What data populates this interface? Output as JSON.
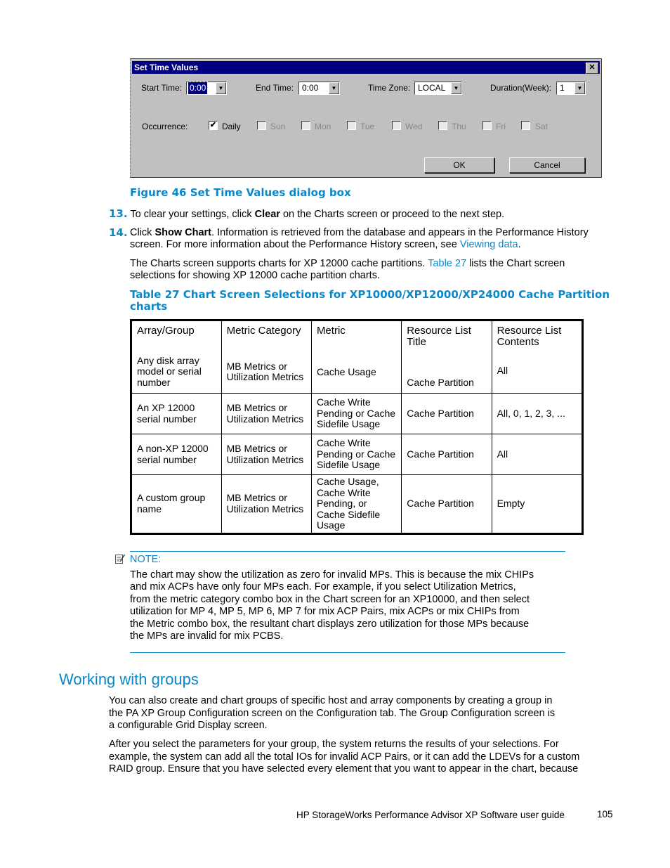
{
  "dialog": {
    "title": "Set Time Values",
    "close_icon": "close-icon",
    "start_time": {
      "label": "Start Time:",
      "value": "0:00"
    },
    "end_time": {
      "label": "End Time:",
      "value": "0:00"
    },
    "time_zone": {
      "label": "Time Zone:",
      "value": "LOCAL"
    },
    "duration": {
      "label": "Duration(Week):",
      "value": "1"
    },
    "occurrence_label": "Occurrence:",
    "occurrences": [
      {
        "label": "Daily",
        "checked": true,
        "enabled": true
      },
      {
        "label": "Sun",
        "checked": false,
        "enabled": false
      },
      {
        "label": "Mon",
        "checked": false,
        "enabled": false
      },
      {
        "label": "Tue",
        "checked": false,
        "enabled": false
      },
      {
        "label": "Wed",
        "checked": false,
        "enabled": false
      },
      {
        "label": "Thu",
        "checked": false,
        "enabled": false
      },
      {
        "label": "Fri",
        "checked": false,
        "enabled": false
      },
      {
        "label": "Sat",
        "checked": false,
        "enabled": false
      }
    ],
    "ok_label": "OK",
    "cancel_label": "Cancel"
  },
  "figure_caption": "Figure 46 Set Time Values dialog box",
  "steps": [
    {
      "num": "13.",
      "pre": "To clear your settings, click ",
      "bold": "Clear",
      "post": " on the Charts screen or proceed to the next step."
    },
    {
      "num": "14.",
      "pre": "Click ",
      "bold": "Show Chart",
      "post": ".  Information is retrieved from the database and appears in the Performance History screen.  For more information about the Performance History screen, see ",
      "link": "Viewing data",
      "end": "."
    }
  ],
  "para_charts": {
    "pre": "The Charts screen supports charts for XP 12000 cache partitions. ",
    "link": "Table 27",
    "post": " lists the Chart screen selections for showing XP 12000 cache partition charts."
  },
  "table_caption": "Table 27 Chart Screen Selections for XP10000/XP12000/XP24000 Cache Partition charts",
  "table": {
    "headers": [
      "Array/Group",
      "Metric Category",
      "Metric",
      "Resource List Title",
      "Resource  List Contents"
    ],
    "rows": [
      [
        "Any disk array model or serial number",
        "MB Metrics or Utilization Metrics",
        "Cache Usage",
        "Cache Partition",
        "All"
      ],
      [
        "An XP 12000 serial number",
        "MB Metrics or Utilization Metrics",
        "Cache  Write Pending or Cache Sidefile Usage",
        "Cache Partition",
        "All, 0, 1, 2, 3, ..."
      ],
      [
        "A non-XP 12000 serial number",
        "MB Metrics or Utilization Metrics",
        "Cache  Write Pending or Cache Sidefile Usage",
        "Cache Partition",
        "All"
      ],
      [
        "A custom group name",
        "MB Metrics or Utilization Metrics",
        "Cache Usage, Cache  Write Pending, or Cache Sidefile Usage",
        "Cache Partition",
        "Empty"
      ]
    ]
  },
  "note": {
    "icon": "note-icon",
    "label": "NOTE:",
    "lines": [
      "The chart may show the utilization as zero for invalid MPs.  This is because the mix CHIPs",
      "and mix ACPs have only four MPs each.  For example, if you select Utilization Metrics,",
      "from the metric category combo box in the Chart screen for an XP10000, and then select",
      "utilization for MP 4, MP 5, MP 6, MP 7 for mix ACP Pairs, mix ACPs or mix CHIPs from",
      "the Metric combo box, the resultant chart displays zero utilization for those MPs because",
      "the MPs are invalid for mix PCBS."
    ]
  },
  "section": {
    "heading": "Working with groups",
    "para1_lines": [
      "You can also create and chart groups of specific host and array components by creating a group in",
      "the PA XP Group Configuration screen on the Configuration tab.  The Group Configuration screen is",
      "a configurable Grid Display screen."
    ],
    "para2_lines": [
      "After you select the parameters for your group, the system returns the results of your selections.  For",
      "example, the system can add all the total IOs for invalid ACP Pairs, or it can add the LDEVs for a custom",
      "RAID group.  Ensure that you have selected every element that you want to appear in the chart, because"
    ]
  },
  "footer": {
    "title": "HP StorageWorks Performance Advisor XP Software user guide",
    "page": "105"
  }
}
